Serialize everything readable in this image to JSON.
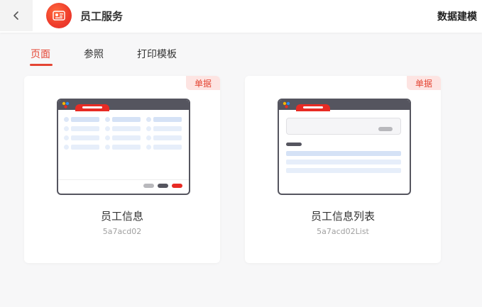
{
  "header": {
    "title": "员工服务",
    "right_label": "数据建模",
    "back_icon": "chevron-left-icon",
    "logo_icon": "app-logo-icon"
  },
  "tabs": [
    {
      "label": "页面",
      "active": true
    },
    {
      "label": "参照",
      "active": false
    },
    {
      "label": "打印模板",
      "active": false
    }
  ],
  "cards": [
    {
      "badge": "单据",
      "name": "员工信息",
      "id": "5a7acd02",
      "preview": "form"
    },
    {
      "badge": "单据",
      "name": "员工信息列表",
      "id": "5a7acd02List",
      "preview": "list"
    }
  ],
  "colors": {
    "accent": "#e44533",
    "badge_bg": "#fde4e2",
    "preview_frame": "#55555f"
  }
}
